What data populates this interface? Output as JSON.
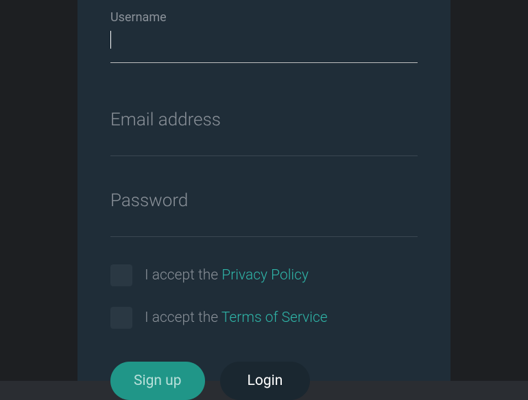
{
  "form": {
    "username": {
      "label": "Username",
      "value": ""
    },
    "email": {
      "label": "Email address",
      "value": ""
    },
    "password": {
      "label": "Password",
      "value": ""
    },
    "privacy": {
      "prefix": "I accept the ",
      "link": "Privacy Policy"
    },
    "terms": {
      "prefix": "I accept the ",
      "link": "Terms of Service"
    },
    "buttons": {
      "signup": "Sign up",
      "login": "Login"
    }
  }
}
